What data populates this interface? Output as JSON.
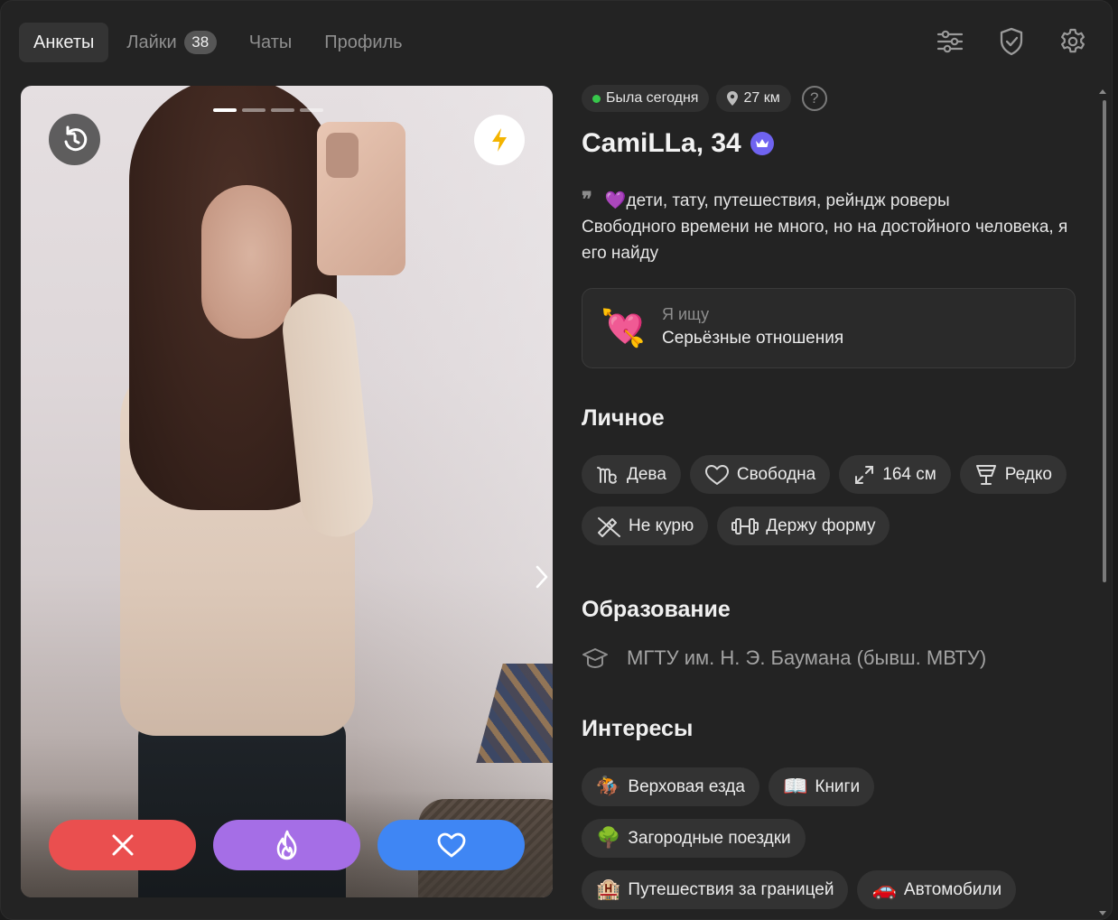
{
  "nav": {
    "tabs": [
      {
        "label": "Анкеты",
        "active": true
      },
      {
        "label": "Лайки",
        "badge": "38"
      },
      {
        "label": "Чаты"
      },
      {
        "label": "Профиль"
      }
    ],
    "icons": [
      "filters-icon",
      "shield-check-icon",
      "gear-icon"
    ]
  },
  "photo": {
    "count": 4,
    "current": 1,
    "actions": [
      "close-icon",
      "flame-icon",
      "heart-icon"
    ],
    "colors": {
      "dislike": "#ea4f4f",
      "super": "#a56ee6",
      "like": "#3f86f4"
    }
  },
  "profile": {
    "status": "Была сегодня",
    "distance": "27 км",
    "help": "?",
    "name": "CamiLLa, 34",
    "bio_line1": "💜дети, тату, путешествия, рейндж роверы",
    "bio_line2": "Свободного времени не много, но на достойного человека, я его найду",
    "seeking_label": "Я ищу",
    "seeking_value": "Серьёзные отношения"
  },
  "personal": {
    "title": "Личное",
    "items": [
      {
        "icon": "virgo-icon",
        "label": "Дева"
      },
      {
        "icon": "heart-outline-icon",
        "label": "Свободна"
      },
      {
        "icon": "height-arrows-icon",
        "label": "164 см"
      },
      {
        "icon": "wine-glass-icon",
        "label": "Редко"
      },
      {
        "icon": "no-smoking-icon",
        "label": "Не курю"
      },
      {
        "icon": "dumbbell-icon",
        "label": "Держу форму"
      }
    ]
  },
  "education": {
    "title": "Образование",
    "value": "МГТУ им. Н. Э. Баумана (бывш. МВТУ)"
  },
  "interests": {
    "title": "Интересы",
    "items": [
      {
        "emoji": "🏇",
        "label": "Верховая езда"
      },
      {
        "emoji": "📖",
        "label": "Книги"
      },
      {
        "emoji": "🌳",
        "label": "Загородные поездки"
      },
      {
        "emoji": "🏨",
        "label": "Путешествия за границей"
      },
      {
        "emoji": "🚗",
        "label": "Автомобили"
      }
    ]
  }
}
